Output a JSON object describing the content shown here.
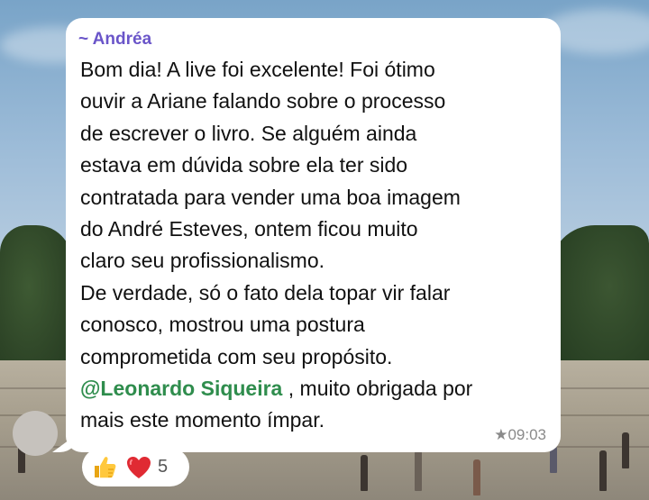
{
  "message": {
    "sender": "~ Andréa",
    "lines": [
      "Bom dia! A live foi excelente! Foi ótimo",
      "ouvir a Ariane falando sobre o processo",
      "de escrever o livro. Se alguém ainda",
      "estava em dúvida sobre ela ter sido",
      "contratada para vender uma boa imagem",
      "do André Esteves, ontem ficou muito",
      "claro seu profissionalismo.",
      "De verdade, só o fato dela topar vir falar",
      "conosco, mostrou uma postura",
      "comprometida com seu propósito."
    ],
    "mention": "@Leonardo Siqueira",
    "mention_suffix": " , muito obrigada por",
    "last_line": "mais este momento ímpar.",
    "time": "09:03",
    "star": "★",
    "sender_color": "#6a55c9",
    "mention_color": "#2f8d4d"
  },
  "reactions": {
    "icons": [
      "thumbs-up-emoji",
      "red-heart-emoji"
    ],
    "count": "5"
  }
}
